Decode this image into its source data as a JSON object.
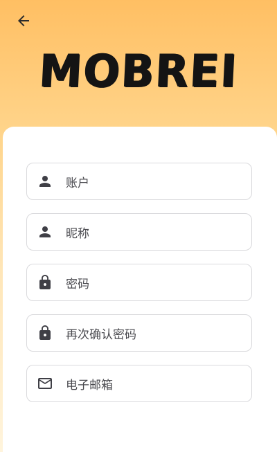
{
  "header": {
    "back_icon": "arrow-left-icon",
    "logo_text": "MOBREI"
  },
  "form": {
    "fields": [
      {
        "icon": "person-icon",
        "placeholder": "账户"
      },
      {
        "icon": "person-icon",
        "placeholder": "昵称"
      },
      {
        "icon": "lock-icon",
        "placeholder": "密码"
      },
      {
        "icon": "lock-icon",
        "placeholder": "再次确认密码"
      },
      {
        "icon": "mail-icon",
        "placeholder": "电子邮箱"
      }
    ]
  },
  "colors": {
    "gradient_top": "#ffbf63",
    "icon": "#3f3f46",
    "card": "#ffffff",
    "border": "#d9d9dc"
  }
}
